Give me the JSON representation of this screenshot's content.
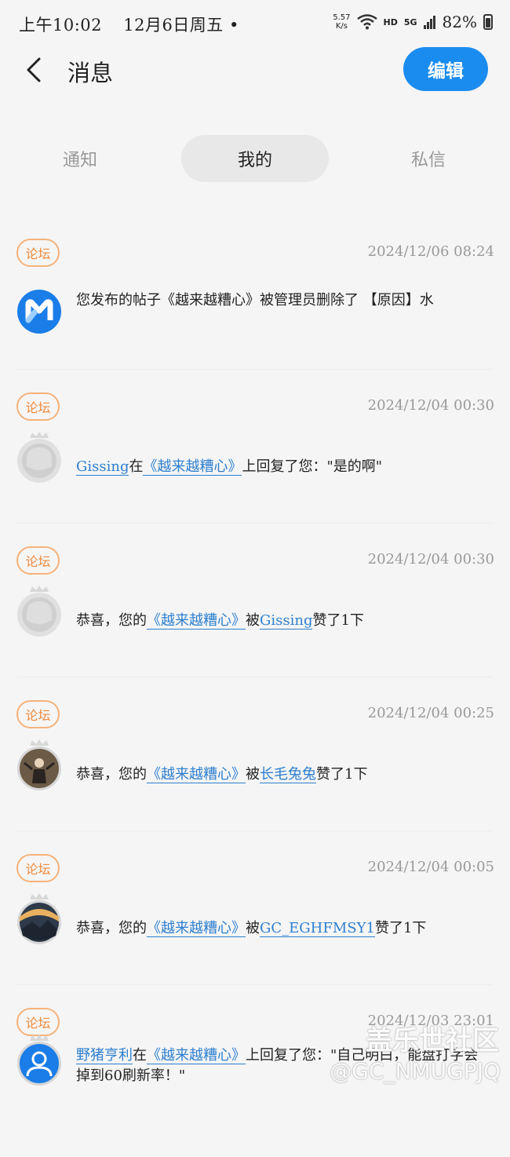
{
  "status_bar": {
    "time": "上午10:02",
    "date": "12月6日周五",
    "dot": "•",
    "speed_value": "5.57",
    "speed_unit": "K/s",
    "hd": "HD",
    "signal": "5G",
    "battery": "82%"
  },
  "header": {
    "title": "消息",
    "edit_label": "编辑"
  },
  "tabs": [
    {
      "label": "通知",
      "active": false
    },
    {
      "label": "我的",
      "active": true
    },
    {
      "label": "私信",
      "active": false
    }
  ],
  "messages": [
    {
      "badge": "论坛",
      "time": "2024/12/06 08:24",
      "avatar": "forum-logo",
      "text": "您发布的帖子《越来越糟心》被管理员删除了 【原因】水"
    },
    {
      "badge": "论坛",
      "time": "2024/12/04 00:30",
      "avatar": "default-user",
      "user": "Gissing",
      "mid1": "在",
      "post": "《越来越糟心》",
      "tail": "上回复了您：\"是的啊\""
    },
    {
      "badge": "论坛",
      "time": "2024/12/04 00:30",
      "avatar": "default-user",
      "prefix": "恭喜，您的",
      "post": "《越来越糟心》",
      "mid": "被",
      "user": "Gissing",
      "tail": "赞了1下"
    },
    {
      "badge": "论坛",
      "time": "2024/12/04 00:25",
      "avatar": "photo-user",
      "prefix": "恭喜，您的",
      "post": "《越来越糟心》",
      "mid": "被",
      "user": "长毛兔兔",
      "tail": "赞了1下"
    },
    {
      "badge": "论坛",
      "time": "2024/12/04 00:05",
      "avatar": "landscape-user",
      "prefix": "恭喜，您的",
      "post": "《越来越糟心》",
      "mid": "被",
      "user": "GC_EGHFMSY1",
      "tail": "赞了1下"
    },
    {
      "badge": "论坛",
      "time": "2024/12/03 23:01",
      "avatar": "blue-user",
      "user": "野猪亨利",
      "mid1": "在",
      "post": "《越来越糟心》",
      "tail": "上回复了您：\"自己明白，能盘打字会掉到60刷新率！\""
    }
  ],
  "watermark": {
    "line1": "盖乐世社区",
    "line2": "@GC_NMUGPJQ"
  }
}
